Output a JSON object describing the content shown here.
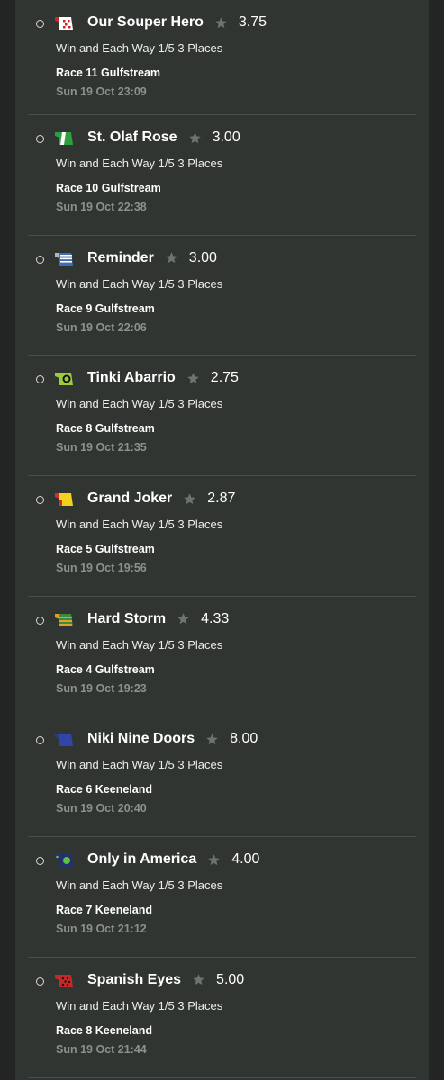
{
  "bets": [
    {
      "horse": "Our Souper Hero",
      "odds": "3.75",
      "market": "Win and Each Way 1/5 3 Places",
      "race": "Race 11 Gulfstream",
      "time": "Sun 19 Oct 23:09",
      "silk_icon": "silk-red-white-diamonds-icon",
      "silk_colors": [
        "#c62828",
        "#ffffff"
      ]
    },
    {
      "horse": "St. Olaf Rose",
      "odds": "3.00",
      "market": "Win and Each Way 1/5 3 Places",
      "race": "Race 10 Gulfstream",
      "time": "Sun 19 Oct 22:38",
      "silk_icon": "silk-green-white-icon",
      "silk_colors": [
        "#2e9e3e",
        "#ffffff"
      ]
    },
    {
      "horse": "Reminder",
      "odds": "3.00",
      "market": "Win and Each Way 1/5 3 Places",
      "race": "Race 9 Gulfstream",
      "time": "Sun 19 Oct 22:06",
      "silk_icon": "silk-blue-white-stripes-icon",
      "silk_colors": [
        "#3f6fb0",
        "#ffffff"
      ]
    },
    {
      "horse": "Tinki Abarrio",
      "odds": "2.75",
      "market": "Win and Each Way 1/5 3 Places",
      "race": "Race 8 Gulfstream",
      "time": "Sun 19 Oct 21:35",
      "silk_icon": "silk-lime-black-circle-icon",
      "silk_colors": [
        "#9ccc3a",
        "#111111"
      ]
    },
    {
      "horse": "Grand Joker",
      "odds": "2.87",
      "market": "Win and Each Way 1/5 3 Places",
      "race": "Race 5 Gulfstream",
      "time": "Sun 19 Oct 19:56",
      "silk_icon": "silk-yellow-red-icon",
      "silk_colors": [
        "#f2d21b",
        "#d32f2f"
      ]
    },
    {
      "horse": "Hard Storm",
      "odds": "4.33",
      "market": "Win and Each Way 1/5 3 Places",
      "race": "Race 4 Gulfstream",
      "time": "Sun 19 Oct 19:23",
      "silk_icon": "silk-green-orange-hoops-icon",
      "silk_colors": [
        "#3d8a3d",
        "#e0a030"
      ]
    },
    {
      "horse": "Niki Nine Doors",
      "odds": "8.00",
      "market": "Win and Each Way 1/5 3 Places",
      "race": "Race 6 Keeneland",
      "time": "Sun 19 Oct 20:40",
      "silk_icon": "silk-royal-blue-icon",
      "silk_colors": [
        "#3344a8",
        "#2a3890"
      ]
    },
    {
      "horse": "Only in America",
      "odds": "4.00",
      "market": "Win and Each Way 1/5 3 Places",
      "race": "Race 7 Keeneland",
      "time": "Sun 19 Oct 21:12",
      "silk_icon": "silk-navy-green-spot-icon",
      "silk_colors": [
        "#24306e",
        "#5cc04a"
      ]
    },
    {
      "horse": "Spanish Eyes",
      "odds": "5.00",
      "market": "Win and Each Way 1/5 3 Places",
      "race": "Race 8 Keeneland",
      "time": "Sun 19 Oct 21:44",
      "silk_icon": "silk-red-black-dots-icon",
      "silk_colors": [
        "#c62828",
        "#111111"
      ]
    }
  ],
  "colors": {
    "background": "#232625",
    "panel": "#303532",
    "divider": "#4a4f4c",
    "star": "#6f7370",
    "time_text": "#8c918e"
  }
}
